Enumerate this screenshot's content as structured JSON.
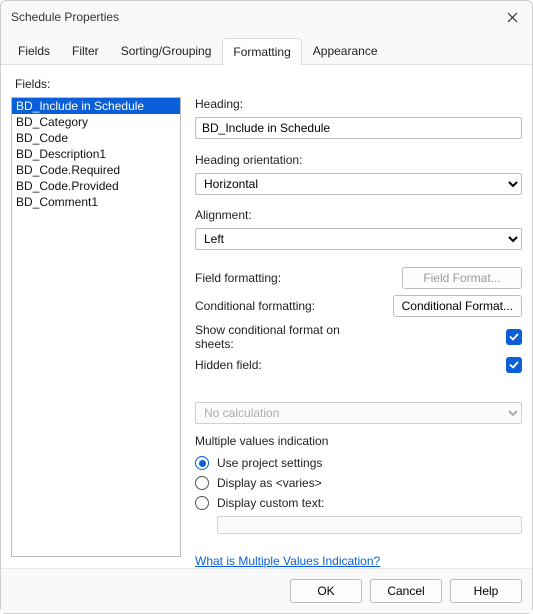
{
  "window": {
    "title": "Schedule Properties"
  },
  "tabs": [
    "Fields",
    "Filter",
    "Sorting/Grouping",
    "Formatting",
    "Appearance"
  ],
  "active_tab_index": 3,
  "fields_label": "Fields:",
  "fields": [
    "BD_Include in Schedule",
    "BD_Category",
    "BD_Code",
    "BD_Description1",
    "BD_Code.Required",
    "BD_Code.Provided",
    "BD_Comment1"
  ],
  "selected_field_index": 0,
  "right": {
    "heading_label": "Heading:",
    "heading_value": "BD_Include in Schedule",
    "heading_orientation_label": "Heading orientation:",
    "heading_orientation_value": "Horizontal",
    "alignment_label": "Alignment:",
    "alignment_value": "Left",
    "field_formatting_label": "Field formatting:",
    "field_format_btn": "Field Format...",
    "conditional_formatting_label": "Conditional formatting:",
    "conditional_format_btn": "Conditional  Format...",
    "show_cond_label": "Show conditional format on sheets:",
    "hidden_field_label": "Hidden field:",
    "calc_value": "No calculation",
    "multi_label": "Multiple values indication",
    "radios": [
      "Use project settings",
      "Display as <varies>",
      "Display custom text:"
    ],
    "selected_radio_index": 0,
    "link": "What is Multiple Values Indication?"
  },
  "footer": {
    "ok": "OK",
    "cancel": "Cancel",
    "help": "Help"
  }
}
